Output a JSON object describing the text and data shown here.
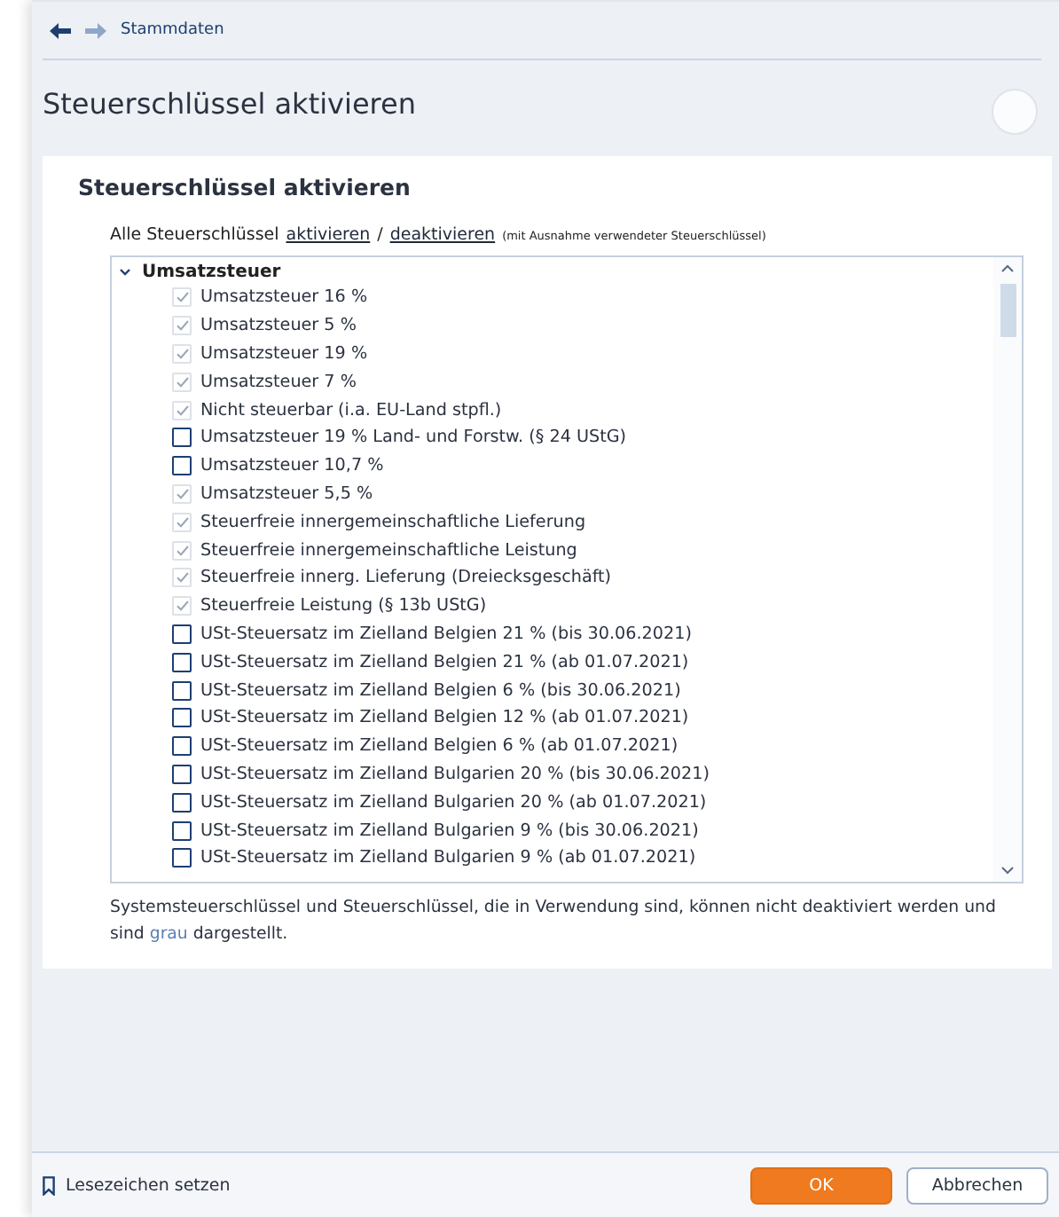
{
  "breadcrumb": {
    "label": "Stammdaten"
  },
  "page_title": "Steuerschlüssel aktivieren",
  "card": {
    "heading": "Steuerschlüssel aktivieren",
    "bulk_line": {
      "prefix": "Alle Steuerschlüssel",
      "activate_link": "aktivieren",
      "separator": "/",
      "deactivate_link": "deaktivieren",
      "hint": "(mit Ausnahme verwendeter Steuerschlüssel)"
    },
    "tree": {
      "group": {
        "label": "Umsatzsteuer",
        "expanded": true
      },
      "items": [
        {
          "label": "Umsatzsteuer 16 %",
          "checked": true,
          "disabled": true
        },
        {
          "label": "Umsatzsteuer 5 %",
          "checked": true,
          "disabled": true
        },
        {
          "label": "Umsatzsteuer 19 %",
          "checked": true,
          "disabled": true
        },
        {
          "label": "Umsatzsteuer 7 %",
          "checked": true,
          "disabled": true
        },
        {
          "label": "Nicht steuerbar (i.a. EU-Land stpfl.)",
          "checked": true,
          "disabled": true
        },
        {
          "label": "Umsatzsteuer 19 % Land- und Forstw. (§ 24 UStG)",
          "checked": false,
          "disabled": false
        },
        {
          "label": "Umsatzsteuer 10,7 %",
          "checked": false,
          "disabled": false
        },
        {
          "label": "Umsatzsteuer 5,5 %",
          "checked": true,
          "disabled": true
        },
        {
          "label": "Steuerfreie innergemeinschaftliche Lieferung",
          "checked": true,
          "disabled": true
        },
        {
          "label": "Steuerfreie innergemeinschaftliche Leistung",
          "checked": true,
          "disabled": true
        },
        {
          "label": "Steuerfreie innerg. Lieferung (Dreiecksgeschäft)",
          "checked": true,
          "disabled": true
        },
        {
          "label": "Steuerfreie Leistung (§ 13b UStG)",
          "checked": true,
          "disabled": true
        },
        {
          "label": "USt-Steuersatz im Zielland Belgien 21 % (bis 30.06.2021)",
          "checked": false,
          "disabled": false
        },
        {
          "label": "USt-Steuersatz im Zielland Belgien 21 % (ab 01.07.2021)",
          "checked": false,
          "disabled": false
        },
        {
          "label": "USt-Steuersatz im Zielland Belgien 6 % (bis 30.06.2021)",
          "checked": false,
          "disabled": false
        },
        {
          "label": "USt-Steuersatz im Zielland Belgien 12 % (ab 01.07.2021)",
          "checked": false,
          "disabled": false
        },
        {
          "label": "USt-Steuersatz im Zielland Belgien 6 % (ab 01.07.2021)",
          "checked": false,
          "disabled": false
        },
        {
          "label": "USt-Steuersatz im Zielland Bulgarien 20 % (bis 30.06.2021)",
          "checked": false,
          "disabled": false
        },
        {
          "label": "USt-Steuersatz im Zielland Bulgarien 20 % (ab 01.07.2021)",
          "checked": false,
          "disabled": false
        },
        {
          "label": "USt-Steuersatz im Zielland Bulgarien 9 % (bis 30.06.2021)",
          "checked": false,
          "disabled": false
        },
        {
          "label": "USt-Steuersatz im Zielland Bulgarien 9 % (ab 01.07.2021)",
          "checked": false,
          "disabled": false
        }
      ]
    },
    "note": {
      "before": "Systemsteuerschlüssel und Steuerschlüssel, die in Verwendung sind, können nicht deaktiviert werden und sind",
      "highlight": "grau",
      "after": "dargestellt."
    }
  },
  "footer": {
    "bookmark": "Lesezeichen setzen",
    "buttons": [
      {
        "label": "OK",
        "kind": "primary"
      },
      {
        "label": "Abbrechen",
        "kind": "secondary"
      }
    ]
  }
}
